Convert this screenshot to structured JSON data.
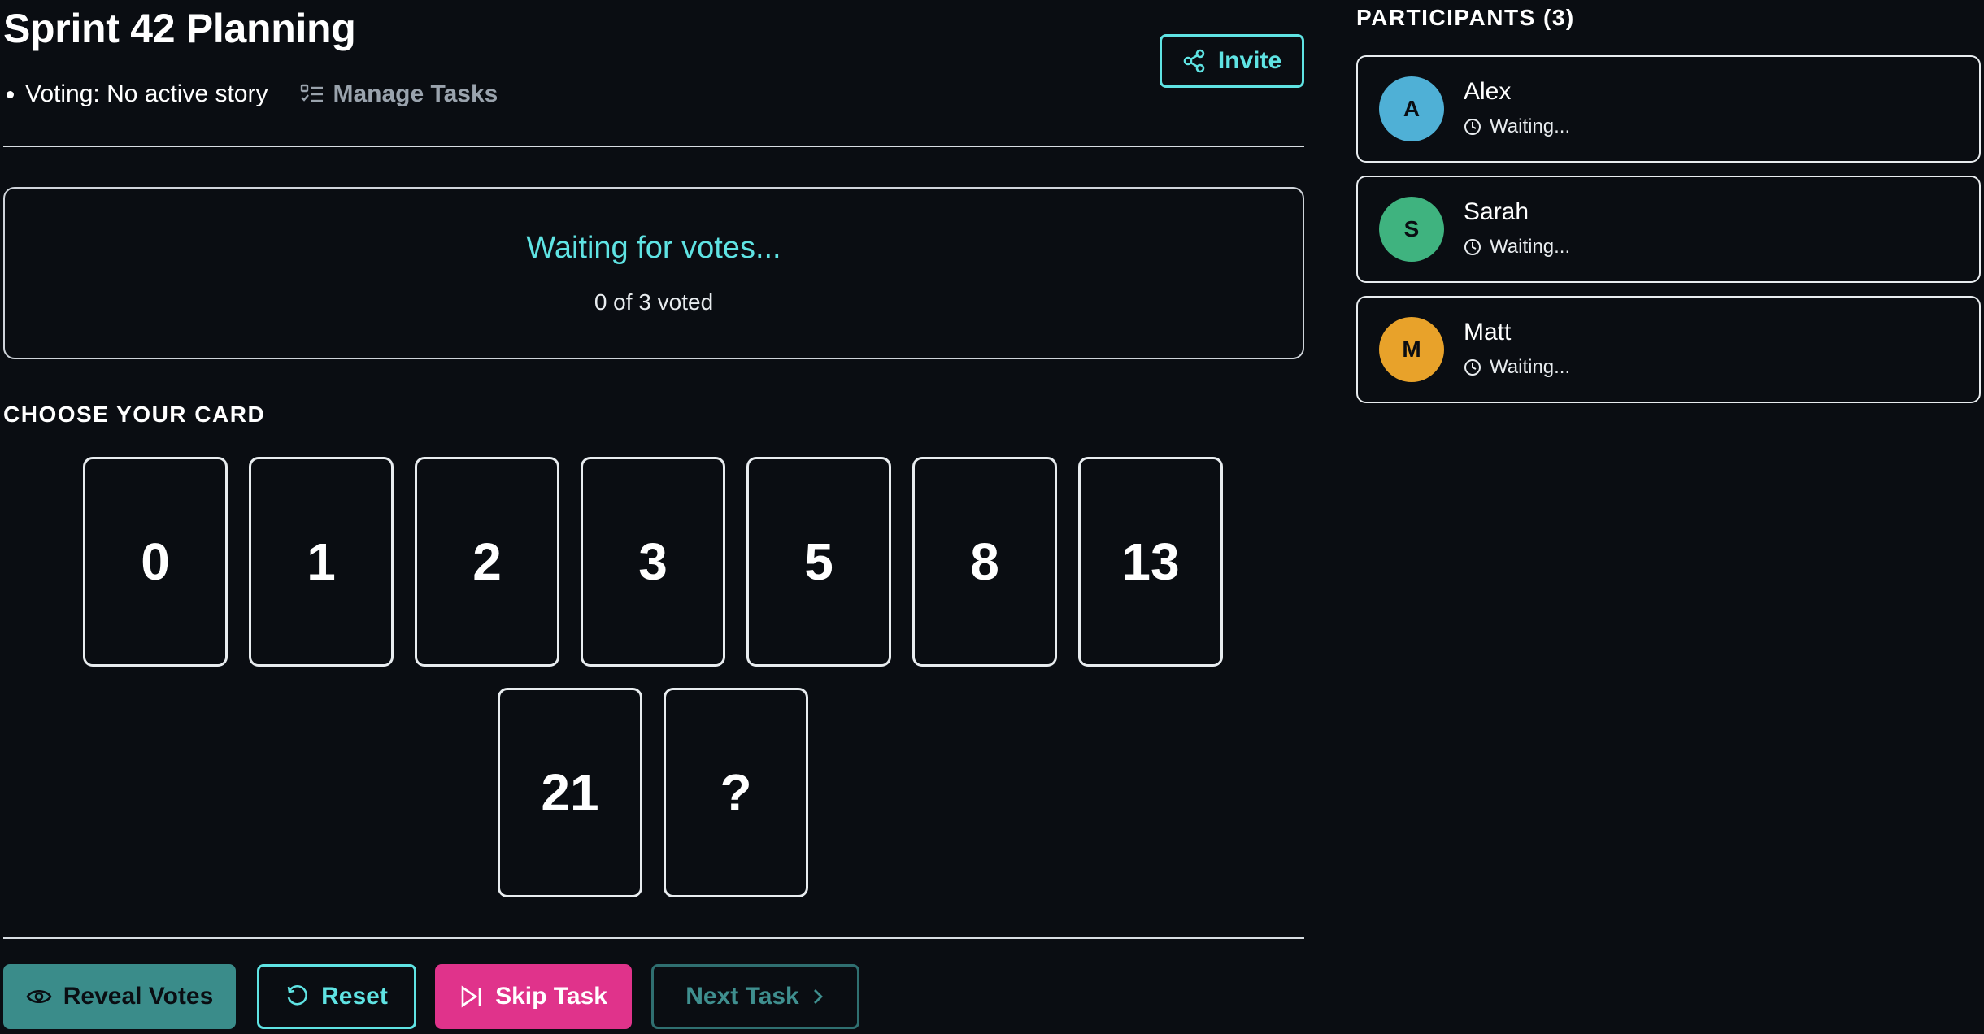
{
  "session": {
    "title": "Sprint 42 Planning",
    "voting_status": "Voting: No active story",
    "manage_tasks_label": "Manage Tasks",
    "invite_label": "Invite"
  },
  "status": {
    "waiting_text": "Waiting for votes...",
    "vote_count_text": "0 of 3 voted"
  },
  "cards": {
    "section_label": "CHOOSE YOUR CARD",
    "values": [
      "0",
      "1",
      "2",
      "3",
      "5",
      "8",
      "13",
      "21",
      "?"
    ]
  },
  "actions": {
    "reveal_label": "Reveal Votes",
    "reset_label": "Reset",
    "skip_label": "Skip Task",
    "next_label": "Next Task"
  },
  "participants": {
    "title": "PARTICIPANTS (3)",
    "items": [
      {
        "initial": "A",
        "name": "Alex",
        "status": "Waiting...",
        "color": "#4fb0d6"
      },
      {
        "initial": "S",
        "name": "Sarah",
        "status": "Waiting...",
        "color": "#3fb37f"
      },
      {
        "initial": "M",
        "name": "Matt",
        "status": "Waiting...",
        "color": "#e8a22a"
      }
    ]
  },
  "colors": {
    "accent": "#5fe3e3",
    "skip": "#e0338b",
    "reveal": "#3a8c8a",
    "background": "#0a0d12"
  }
}
